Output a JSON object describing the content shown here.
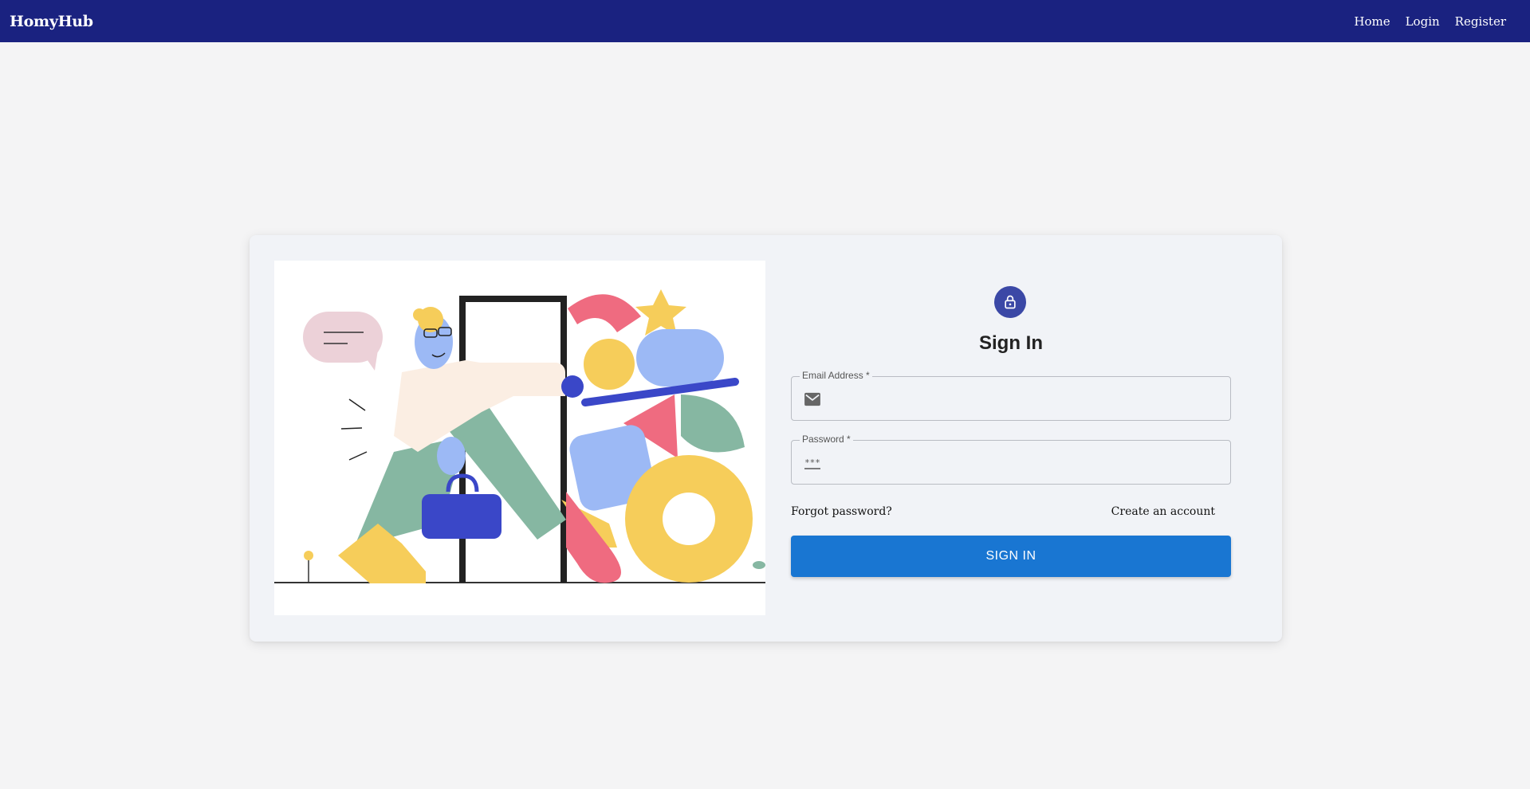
{
  "navbar": {
    "brand": "HomyHub",
    "links": [
      "Home",
      "Login",
      "Register"
    ],
    "background": "#1a2280"
  },
  "illustration": {
    "icon": "person-entering-door-illustration"
  },
  "form": {
    "avatar_icon": "lock-icon",
    "title": "Sign In",
    "email": {
      "label": "Email Address *",
      "value": "",
      "icon": "mail-icon"
    },
    "password": {
      "label": "Password *",
      "value": "",
      "icon": "password-dots-icon"
    },
    "forgot_label": "Forgot password?",
    "create_label": "Create an account",
    "submit_label": "SIGN IN",
    "accent_color": "#1976d2",
    "avatar_color": "#3b48a6"
  }
}
